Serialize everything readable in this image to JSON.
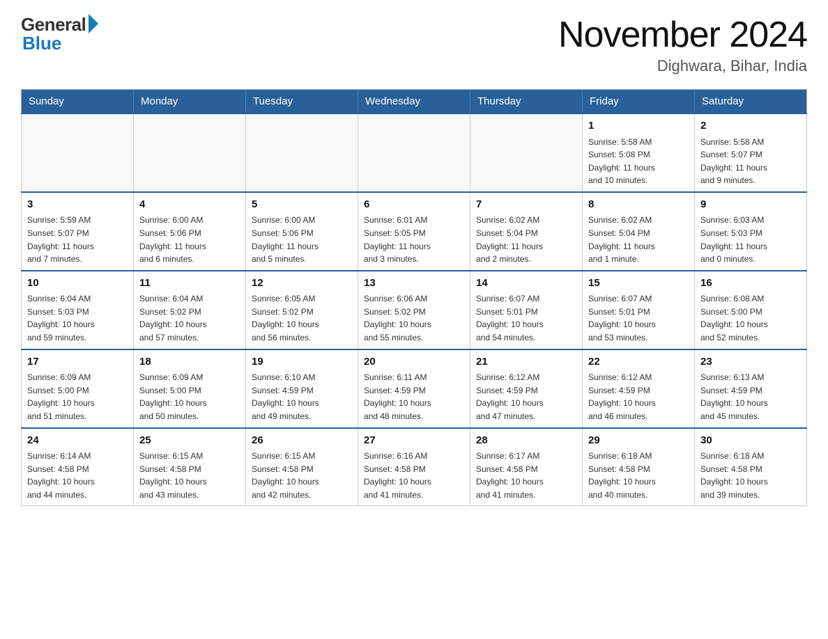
{
  "header": {
    "logo_general": "General",
    "logo_blue": "Blue",
    "month_title": "November 2024",
    "location": "Dighwara, Bihar, India"
  },
  "days_of_week": [
    "Sunday",
    "Monday",
    "Tuesday",
    "Wednesday",
    "Thursday",
    "Friday",
    "Saturday"
  ],
  "weeks": [
    [
      {
        "day": "",
        "info": ""
      },
      {
        "day": "",
        "info": ""
      },
      {
        "day": "",
        "info": ""
      },
      {
        "day": "",
        "info": ""
      },
      {
        "day": "",
        "info": ""
      },
      {
        "day": "1",
        "info": "Sunrise: 5:58 AM\nSunset: 5:08 PM\nDaylight: 11 hours\nand 10 minutes."
      },
      {
        "day": "2",
        "info": "Sunrise: 5:58 AM\nSunset: 5:07 PM\nDaylight: 11 hours\nand 9 minutes."
      }
    ],
    [
      {
        "day": "3",
        "info": "Sunrise: 5:59 AM\nSunset: 5:07 PM\nDaylight: 11 hours\nand 7 minutes."
      },
      {
        "day": "4",
        "info": "Sunrise: 6:00 AM\nSunset: 5:06 PM\nDaylight: 11 hours\nand 6 minutes."
      },
      {
        "day": "5",
        "info": "Sunrise: 6:00 AM\nSunset: 5:06 PM\nDaylight: 11 hours\nand 5 minutes."
      },
      {
        "day": "6",
        "info": "Sunrise: 6:01 AM\nSunset: 5:05 PM\nDaylight: 11 hours\nand 3 minutes."
      },
      {
        "day": "7",
        "info": "Sunrise: 6:02 AM\nSunset: 5:04 PM\nDaylight: 11 hours\nand 2 minutes."
      },
      {
        "day": "8",
        "info": "Sunrise: 6:02 AM\nSunset: 5:04 PM\nDaylight: 11 hours\nand 1 minute."
      },
      {
        "day": "9",
        "info": "Sunrise: 6:03 AM\nSunset: 5:03 PM\nDaylight: 11 hours\nand 0 minutes."
      }
    ],
    [
      {
        "day": "10",
        "info": "Sunrise: 6:04 AM\nSunset: 5:03 PM\nDaylight: 10 hours\nand 59 minutes."
      },
      {
        "day": "11",
        "info": "Sunrise: 6:04 AM\nSunset: 5:02 PM\nDaylight: 10 hours\nand 57 minutes."
      },
      {
        "day": "12",
        "info": "Sunrise: 6:05 AM\nSunset: 5:02 PM\nDaylight: 10 hours\nand 56 minutes."
      },
      {
        "day": "13",
        "info": "Sunrise: 6:06 AM\nSunset: 5:02 PM\nDaylight: 10 hours\nand 55 minutes."
      },
      {
        "day": "14",
        "info": "Sunrise: 6:07 AM\nSunset: 5:01 PM\nDaylight: 10 hours\nand 54 minutes."
      },
      {
        "day": "15",
        "info": "Sunrise: 6:07 AM\nSunset: 5:01 PM\nDaylight: 10 hours\nand 53 minutes."
      },
      {
        "day": "16",
        "info": "Sunrise: 6:08 AM\nSunset: 5:00 PM\nDaylight: 10 hours\nand 52 minutes."
      }
    ],
    [
      {
        "day": "17",
        "info": "Sunrise: 6:09 AM\nSunset: 5:00 PM\nDaylight: 10 hours\nand 51 minutes."
      },
      {
        "day": "18",
        "info": "Sunrise: 6:09 AM\nSunset: 5:00 PM\nDaylight: 10 hours\nand 50 minutes."
      },
      {
        "day": "19",
        "info": "Sunrise: 6:10 AM\nSunset: 4:59 PM\nDaylight: 10 hours\nand 49 minutes."
      },
      {
        "day": "20",
        "info": "Sunrise: 6:11 AM\nSunset: 4:59 PM\nDaylight: 10 hours\nand 48 minutes."
      },
      {
        "day": "21",
        "info": "Sunrise: 6:12 AM\nSunset: 4:59 PM\nDaylight: 10 hours\nand 47 minutes."
      },
      {
        "day": "22",
        "info": "Sunrise: 6:12 AM\nSunset: 4:59 PM\nDaylight: 10 hours\nand 46 minutes."
      },
      {
        "day": "23",
        "info": "Sunrise: 6:13 AM\nSunset: 4:59 PM\nDaylight: 10 hours\nand 45 minutes."
      }
    ],
    [
      {
        "day": "24",
        "info": "Sunrise: 6:14 AM\nSunset: 4:58 PM\nDaylight: 10 hours\nand 44 minutes."
      },
      {
        "day": "25",
        "info": "Sunrise: 6:15 AM\nSunset: 4:58 PM\nDaylight: 10 hours\nand 43 minutes."
      },
      {
        "day": "26",
        "info": "Sunrise: 6:15 AM\nSunset: 4:58 PM\nDaylight: 10 hours\nand 42 minutes."
      },
      {
        "day": "27",
        "info": "Sunrise: 6:16 AM\nSunset: 4:58 PM\nDaylight: 10 hours\nand 41 minutes."
      },
      {
        "day": "28",
        "info": "Sunrise: 6:17 AM\nSunset: 4:58 PM\nDaylight: 10 hours\nand 41 minutes."
      },
      {
        "day": "29",
        "info": "Sunrise: 6:18 AM\nSunset: 4:58 PM\nDaylight: 10 hours\nand 40 minutes."
      },
      {
        "day": "30",
        "info": "Sunrise: 6:18 AM\nSunset: 4:58 PM\nDaylight: 10 hours\nand 39 minutes."
      }
    ]
  ]
}
